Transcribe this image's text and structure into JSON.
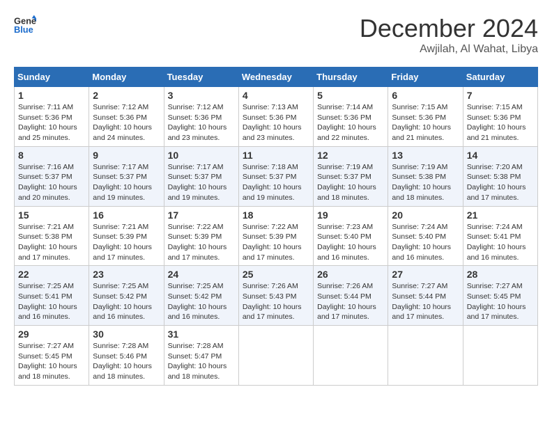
{
  "header": {
    "logo_line1": "General",
    "logo_line2": "Blue",
    "month_title": "December 2024",
    "location": "Awjilah, Al Wahat, Libya"
  },
  "weekdays": [
    "Sunday",
    "Monday",
    "Tuesday",
    "Wednesday",
    "Thursday",
    "Friday",
    "Saturday"
  ],
  "weeks": [
    [
      {
        "day": "1",
        "info": "Sunrise: 7:11 AM\nSunset: 5:36 PM\nDaylight: 10 hours and 25 minutes."
      },
      {
        "day": "2",
        "info": "Sunrise: 7:12 AM\nSunset: 5:36 PM\nDaylight: 10 hours and 24 minutes."
      },
      {
        "day": "3",
        "info": "Sunrise: 7:12 AM\nSunset: 5:36 PM\nDaylight: 10 hours and 23 minutes."
      },
      {
        "day": "4",
        "info": "Sunrise: 7:13 AM\nSunset: 5:36 PM\nDaylight: 10 hours and 23 minutes."
      },
      {
        "day": "5",
        "info": "Sunrise: 7:14 AM\nSunset: 5:36 PM\nDaylight: 10 hours and 22 minutes."
      },
      {
        "day": "6",
        "info": "Sunrise: 7:15 AM\nSunset: 5:36 PM\nDaylight: 10 hours and 21 minutes."
      },
      {
        "day": "7",
        "info": "Sunrise: 7:15 AM\nSunset: 5:36 PM\nDaylight: 10 hours and 21 minutes."
      }
    ],
    [
      {
        "day": "8",
        "info": "Sunrise: 7:16 AM\nSunset: 5:37 PM\nDaylight: 10 hours and 20 minutes."
      },
      {
        "day": "9",
        "info": "Sunrise: 7:17 AM\nSunset: 5:37 PM\nDaylight: 10 hours and 19 minutes."
      },
      {
        "day": "10",
        "info": "Sunrise: 7:17 AM\nSunset: 5:37 PM\nDaylight: 10 hours and 19 minutes."
      },
      {
        "day": "11",
        "info": "Sunrise: 7:18 AM\nSunset: 5:37 PM\nDaylight: 10 hours and 19 minutes."
      },
      {
        "day": "12",
        "info": "Sunrise: 7:19 AM\nSunset: 5:37 PM\nDaylight: 10 hours and 18 minutes."
      },
      {
        "day": "13",
        "info": "Sunrise: 7:19 AM\nSunset: 5:38 PM\nDaylight: 10 hours and 18 minutes."
      },
      {
        "day": "14",
        "info": "Sunrise: 7:20 AM\nSunset: 5:38 PM\nDaylight: 10 hours and 17 minutes."
      }
    ],
    [
      {
        "day": "15",
        "info": "Sunrise: 7:21 AM\nSunset: 5:38 PM\nDaylight: 10 hours and 17 minutes."
      },
      {
        "day": "16",
        "info": "Sunrise: 7:21 AM\nSunset: 5:39 PM\nDaylight: 10 hours and 17 minutes."
      },
      {
        "day": "17",
        "info": "Sunrise: 7:22 AM\nSunset: 5:39 PM\nDaylight: 10 hours and 17 minutes."
      },
      {
        "day": "18",
        "info": "Sunrise: 7:22 AM\nSunset: 5:39 PM\nDaylight: 10 hours and 17 minutes."
      },
      {
        "day": "19",
        "info": "Sunrise: 7:23 AM\nSunset: 5:40 PM\nDaylight: 10 hours and 16 minutes."
      },
      {
        "day": "20",
        "info": "Sunrise: 7:24 AM\nSunset: 5:40 PM\nDaylight: 10 hours and 16 minutes."
      },
      {
        "day": "21",
        "info": "Sunrise: 7:24 AM\nSunset: 5:41 PM\nDaylight: 10 hours and 16 minutes."
      }
    ],
    [
      {
        "day": "22",
        "info": "Sunrise: 7:25 AM\nSunset: 5:41 PM\nDaylight: 10 hours and 16 minutes."
      },
      {
        "day": "23",
        "info": "Sunrise: 7:25 AM\nSunset: 5:42 PM\nDaylight: 10 hours and 16 minutes."
      },
      {
        "day": "24",
        "info": "Sunrise: 7:25 AM\nSunset: 5:42 PM\nDaylight: 10 hours and 16 minutes."
      },
      {
        "day": "25",
        "info": "Sunrise: 7:26 AM\nSunset: 5:43 PM\nDaylight: 10 hours and 17 minutes."
      },
      {
        "day": "26",
        "info": "Sunrise: 7:26 AM\nSunset: 5:44 PM\nDaylight: 10 hours and 17 minutes."
      },
      {
        "day": "27",
        "info": "Sunrise: 7:27 AM\nSunset: 5:44 PM\nDaylight: 10 hours and 17 minutes."
      },
      {
        "day": "28",
        "info": "Sunrise: 7:27 AM\nSunset: 5:45 PM\nDaylight: 10 hours and 17 minutes."
      }
    ],
    [
      {
        "day": "29",
        "info": "Sunrise: 7:27 AM\nSunset: 5:45 PM\nDaylight: 10 hours and 18 minutes."
      },
      {
        "day": "30",
        "info": "Sunrise: 7:28 AM\nSunset: 5:46 PM\nDaylight: 10 hours and 18 minutes."
      },
      {
        "day": "31",
        "info": "Sunrise: 7:28 AM\nSunset: 5:47 PM\nDaylight: 10 hours and 18 minutes."
      },
      null,
      null,
      null,
      null
    ]
  ]
}
